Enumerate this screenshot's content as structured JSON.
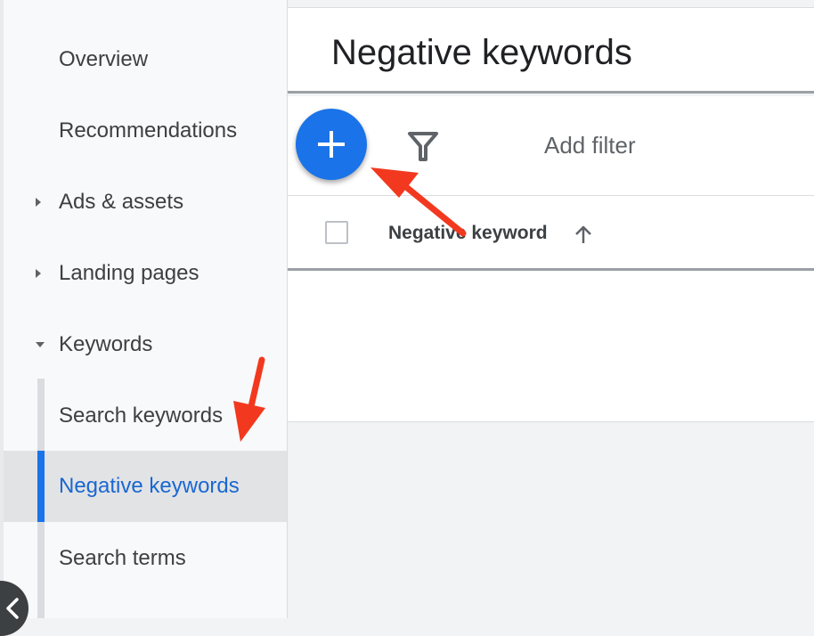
{
  "sidebar": {
    "items": [
      {
        "label": "Overview"
      },
      {
        "label": "Recommendations"
      },
      {
        "label": "Ads & assets"
      },
      {
        "label": "Landing pages"
      },
      {
        "label": "Keywords"
      },
      {
        "label": "Search keywords"
      },
      {
        "label": "Negative keywords"
      },
      {
        "label": "Search terms"
      }
    ]
  },
  "header": {
    "title": "Negative keywords"
  },
  "toolbar": {
    "add_filter_label": "Add filter"
  },
  "table": {
    "columns": [
      {
        "label": "Negative keyword",
        "sort": "ascending"
      }
    ],
    "rows": []
  },
  "colors": {
    "accent": "#1a73e8",
    "active_text": "#1967d2",
    "annotation_arrow": "#f2391f"
  },
  "icons": [
    "plus-icon",
    "filter-icon",
    "sort-ascending-icon",
    "caret-right-icon",
    "caret-down-icon",
    "chevron-left-icon"
  ]
}
